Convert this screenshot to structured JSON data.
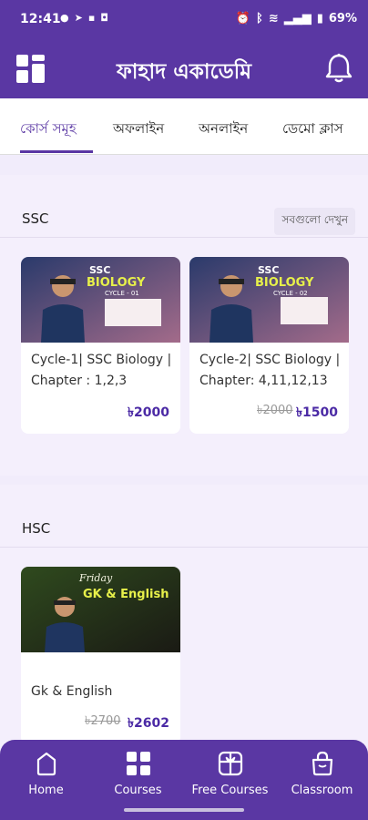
{
  "status": {
    "time": "12:41",
    "battery": "69%"
  },
  "appbar": {
    "title": "ফাহাদ একাডেমি"
  },
  "tabs": [
    {
      "label": "কোর্স সমূহ",
      "active": true
    },
    {
      "label": "অফলাইন",
      "active": false
    },
    {
      "label": "অনলাইন",
      "active": false
    },
    {
      "label": "ডেমো ক্লাস",
      "active": false
    }
  ],
  "sections": [
    {
      "title": "SSC",
      "see_all": "সবগুলো দেখুন",
      "courses": [
        {
          "title": "Cycle-1| SSC Biology | Chapter : 1,2,3",
          "old_price": "",
          "price": "৳2000",
          "thumb_title": "SSC BIOLOGY",
          "thumb_sub": "CYCLE - 01"
        },
        {
          "title": "Cycle-2| SSC Biology | Chapter: 4,11,12,13",
          "old_price": "৳2000",
          "price": "৳1500",
          "thumb_title": "SSC BIOLOGY",
          "thumb_sub": "CYCLE - 02"
        }
      ]
    },
    {
      "title": "HSC",
      "see_all": "",
      "courses": [
        {
          "title": "Gk & English",
          "old_price": "৳2700",
          "price": "৳2602",
          "thumb_title": "GK & English",
          "thumb_sub": "Friday"
        }
      ]
    }
  ],
  "bottomnav": [
    {
      "label": "Home",
      "icon": "home-icon"
    },
    {
      "label": "Courses",
      "icon": "grid-icon"
    },
    {
      "label": "Free Courses",
      "icon": "gift-icon"
    },
    {
      "label": "Classroom",
      "icon": "bag-icon"
    }
  ],
  "colors": {
    "primary": "#5a37a3",
    "price": "#4b2aa5",
    "background": "#f1ecfb"
  }
}
